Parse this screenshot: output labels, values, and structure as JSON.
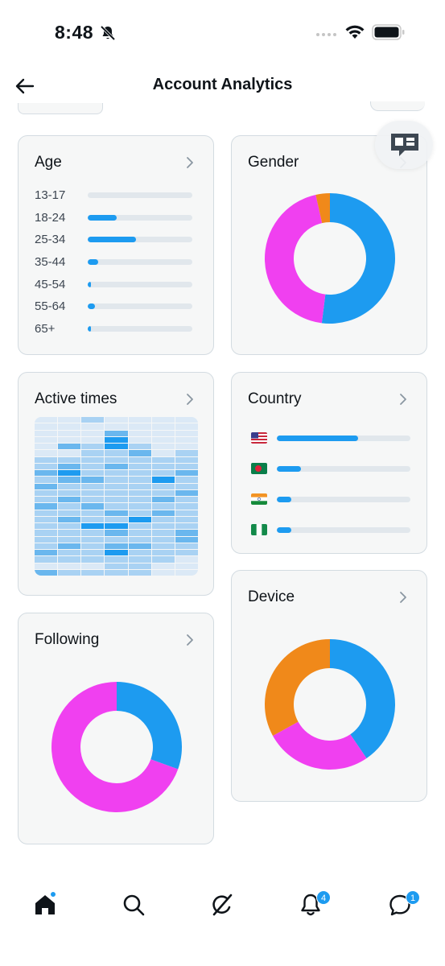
{
  "status_bar": {
    "time": "8:48"
  },
  "header": {
    "title": "Account Analytics"
  },
  "colors": {
    "accent": "#1d9bf0",
    "magenta": "#f040f0",
    "orange": "#f0891a",
    "card_bg": "#f6f7f7",
    "track": "#e1e7ec"
  },
  "cards": {
    "age": {
      "title": "Age",
      "rows": [
        {
          "label": "13-17",
          "fraction": 0.0
        },
        {
          "label": "18-24",
          "fraction": 0.28
        },
        {
          "label": "25-34",
          "fraction": 0.46
        },
        {
          "label": "35-44",
          "fraction": 0.1
        },
        {
          "label": "45-54",
          "fraction": 0.03
        },
        {
          "label": "55-64",
          "fraction": 0.07
        },
        {
          "label": "65+",
          "fraction": 0.03
        }
      ]
    },
    "gender": {
      "title": "Gender",
      "segments": [
        {
          "color": "#1d9bf0",
          "fraction": 0.52
        },
        {
          "color": "#f040f0",
          "fraction": 0.445
        },
        {
          "color": "#f0891a",
          "fraction": 0.035
        }
      ]
    },
    "active_times": {
      "title": "Active times",
      "intensity_rows": [
        [
          0,
          0,
          1,
          0,
          0,
          0,
          0
        ],
        [
          0,
          0,
          0,
          0,
          0,
          0,
          0
        ],
        [
          0,
          0,
          0,
          2,
          0,
          0,
          0
        ],
        [
          0,
          0,
          0,
          3,
          0,
          0,
          0
        ],
        [
          0,
          2,
          1,
          3,
          1,
          0,
          0
        ],
        [
          0,
          0,
          1,
          1,
          2,
          0,
          1
        ],
        [
          1,
          1,
          1,
          1,
          1,
          1,
          1
        ],
        [
          1,
          2,
          1,
          2,
          1,
          1,
          1
        ],
        [
          2,
          3,
          1,
          1,
          1,
          1,
          2
        ],
        [
          1,
          2,
          2,
          1,
          1,
          3,
          1
        ],
        [
          2,
          1,
          1,
          1,
          1,
          1,
          1
        ],
        [
          1,
          1,
          1,
          1,
          1,
          1,
          2
        ],
        [
          1,
          2,
          1,
          1,
          1,
          2,
          1
        ],
        [
          2,
          1,
          2,
          1,
          1,
          1,
          1
        ],
        [
          1,
          1,
          1,
          2,
          1,
          2,
          1
        ],
        [
          1,
          2,
          1,
          1,
          3,
          1,
          1
        ],
        [
          1,
          1,
          3,
          3,
          1,
          1,
          1
        ],
        [
          1,
          1,
          1,
          2,
          1,
          1,
          2
        ],
        [
          1,
          1,
          1,
          1,
          1,
          1,
          2
        ],
        [
          1,
          2,
          1,
          2,
          2,
          1,
          1
        ],
        [
          2,
          1,
          1,
          3,
          1,
          1,
          1
        ],
        [
          1,
          1,
          1,
          1,
          1,
          1,
          0
        ],
        [
          0,
          0,
          0,
          1,
          1,
          0,
          0
        ],
        [
          2,
          1,
          1,
          1,
          1,
          0,
          0
        ]
      ]
    },
    "country": {
      "title": "Country",
      "rows": [
        {
          "flag": "us-flag",
          "fraction": 0.61
        },
        {
          "flag": "bangladesh-flag",
          "fraction": 0.18
        },
        {
          "flag": "india-flag",
          "fraction": 0.11
        },
        {
          "flag": "nigeria-flag",
          "fraction": 0.11
        }
      ]
    },
    "device": {
      "title": "Device",
      "segments": [
        {
          "color": "#1d9bf0",
          "fraction": 0.405
        },
        {
          "color": "#f040f0",
          "fraction": 0.265
        },
        {
          "color": "#f0891a",
          "fraction": 0.33
        }
      ]
    },
    "following": {
      "title": "Following",
      "segments": [
        {
          "color": "#1d9bf0",
          "fraction": 0.305
        },
        {
          "color": "#f040f0",
          "fraction": 0.695
        }
      ]
    }
  },
  "tab_bar": {
    "items": [
      {
        "icon": "home-icon"
      },
      {
        "icon": "search-icon"
      },
      {
        "icon": "grok-icon"
      },
      {
        "icon": "bell-icon",
        "badge": "4"
      },
      {
        "icon": "messages-icon",
        "badge": "1"
      }
    ]
  }
}
